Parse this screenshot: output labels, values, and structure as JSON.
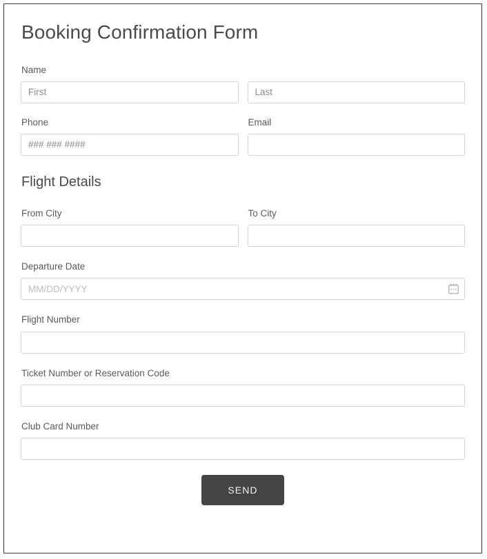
{
  "form": {
    "title": "Booking Confirmation Form",
    "sections": [
      {
        "heading": "Flight Details"
      }
    ],
    "fields": {
      "name": {
        "label": "Name",
        "first": {
          "placeholder": "First",
          "value": ""
        },
        "last": {
          "placeholder": "Last",
          "value": ""
        }
      },
      "phone": {
        "label": "Phone",
        "placeholder": "### ### ####",
        "value": ""
      },
      "email": {
        "label": "Email",
        "placeholder": "",
        "value": ""
      },
      "from_city": {
        "label": "From City",
        "placeholder": "",
        "value": ""
      },
      "to_city": {
        "label": "To City",
        "placeholder": "",
        "value": ""
      },
      "departure_date": {
        "label": "Departure Date",
        "placeholder": "MM/DD/YYYY",
        "value": "",
        "icon": "calendar-icon"
      },
      "flight_number": {
        "label": "Flight Number",
        "placeholder": "",
        "value": ""
      },
      "ticket_number": {
        "label": "Ticket Number or Reservation Code",
        "placeholder": "",
        "value": ""
      },
      "club_card_number": {
        "label": "Club Card Number",
        "placeholder": "",
        "value": ""
      }
    },
    "submit": {
      "label": "SEND"
    }
  },
  "colors": {
    "page_border": "#3c3c3c",
    "title_text": "#4a4a4a",
    "label_text": "#5a5a5a",
    "input_border": "#d4d4d4",
    "placeholder_text": "#8c8c8c",
    "date_placeholder_text": "#bdbdbd",
    "button_background": "#444444",
    "button_text": "#f2f2f2",
    "icon_gray": "#b0b0b0"
  }
}
